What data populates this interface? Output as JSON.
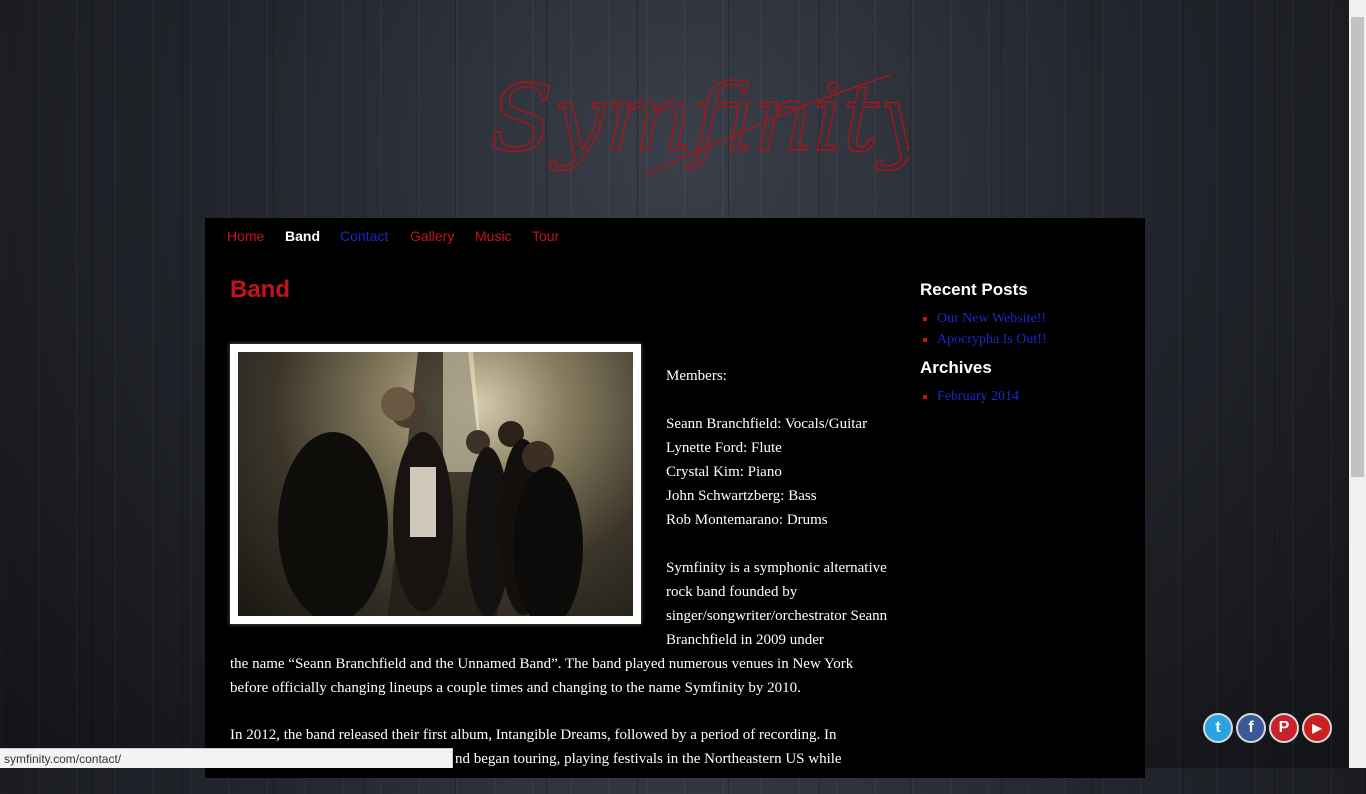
{
  "site": {
    "logo_text": "Symfinity"
  },
  "nav": [
    {
      "label": "Home",
      "state": "link"
    },
    {
      "label": "Band",
      "state": "active"
    },
    {
      "label": "Contact",
      "state": "visited"
    },
    {
      "label": "Gallery",
      "state": "link"
    },
    {
      "label": "Music",
      "state": "link"
    },
    {
      "label": "Tour",
      "state": "link"
    }
  ],
  "page": {
    "title": "Band",
    "members_heading": "Members:",
    "members": [
      "Seann Branchfield: Vocals/Guitar",
      "Lynette Ford: Flute",
      "Crystal Kim: Piano",
      "John Schwartzberg: Bass",
      "Rob Montemarano: Drums"
    ],
    "bio_side": "Symfinity is a symphonic alternative rock band founded by singer/songwriter/orchestrator Seann Branchfield in 2009 under",
    "bio_continued": "the name “Seann Branchfield and the Unnamed Band”. The band played numerous venues in New York before officially changing lineups a couple times and changing to the name Symfinity by 2010.",
    "bio_2012_line1": "In 2012, the band released their first album, Intangible Dreams, followed by a period of recording. In",
    "bio_2012_line2_visible": "nd began touring, playing festivals in the Northeastern US while"
  },
  "sidebar": {
    "recent_posts_title": "Recent Posts",
    "recent_posts": [
      "Our New Website!!",
      "Apocrypha Is Out!!"
    ],
    "archives_title": "Archives",
    "archives": [
      "February 2014"
    ]
  },
  "status_bar": {
    "url": "symfinity.com/contact/"
  },
  "social": [
    {
      "name": "twitter",
      "color": "#2aa3e0",
      "glyph": "t"
    },
    {
      "name": "facebook",
      "color": "#3b5998",
      "glyph": "f"
    },
    {
      "name": "pinterest",
      "color": "#c8232c",
      "glyph": "P"
    },
    {
      "name": "youtube",
      "color": "#cc1f1f",
      "glyph": "▶"
    }
  ],
  "colors": {
    "accent": "#c1151a",
    "link": "#1a28c9",
    "panel": "#000000"
  }
}
